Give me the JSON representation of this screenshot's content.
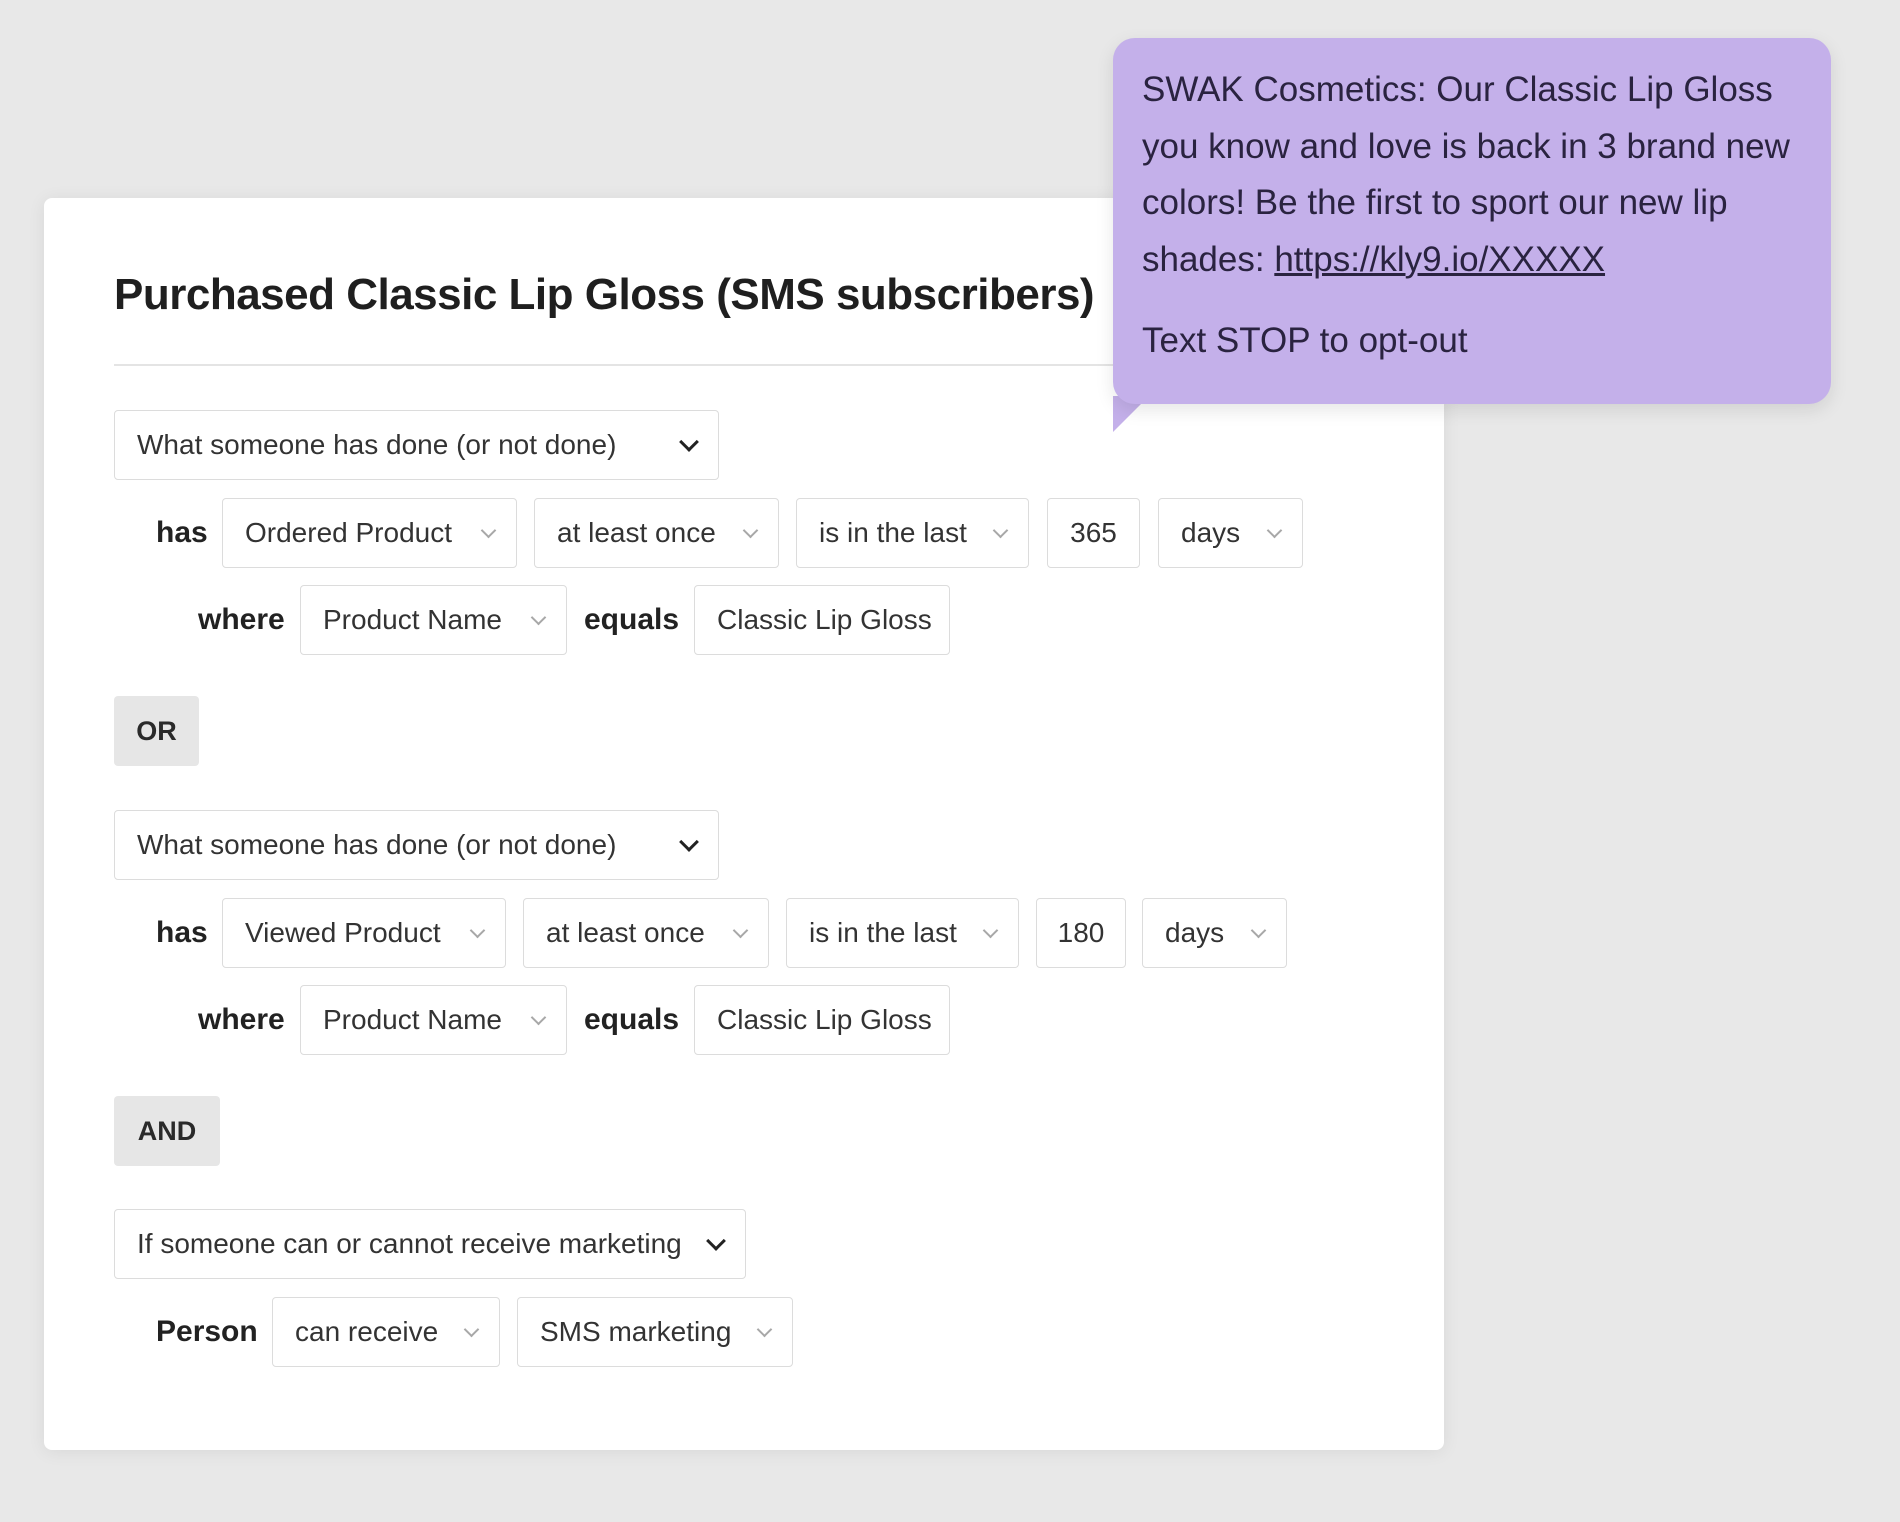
{
  "segment": {
    "title": "Purchased Classic Lip Gloss (SMS subscribers)"
  },
  "groups": [
    {
      "condition_type": "What someone has done (or not done)",
      "has_label": "has",
      "metric": "Ordered Product",
      "frequency": "at least once",
      "timeframe": "is in the last",
      "amount": "365",
      "unit": "days",
      "where_label": "where",
      "property": "Product Name",
      "operator": "equals",
      "value": "Classic Lip Gloss"
    },
    {
      "condition_type": "What someone has done (or not done)",
      "has_label": "has",
      "metric": "Viewed Product",
      "frequency": "at least once",
      "timeframe": "is in the last",
      "amount": "180",
      "unit": "days",
      "where_label": "where",
      "property": "Product Name",
      "operator": "equals",
      "value": "Classic Lip Gloss"
    }
  ],
  "connectors": {
    "or_label": "OR",
    "and_label": "AND"
  },
  "consent": {
    "condition_type": "If someone can or cannot receive marketing",
    "person_label": "Person",
    "status": "can receive",
    "channel": "SMS marketing"
  },
  "sms_preview": {
    "message": "SWAK Cosmetics: Our Classic Lip Gloss you know and love is back in 3 brand new colors! Be the first to sport our new lip shades: ",
    "link": "https://kly9.io/XXXXX",
    "opt_out": "Text STOP to opt-out",
    "color": "#c4b0ea"
  },
  "icons": {
    "dropdown": "chevron-down-icon"
  }
}
